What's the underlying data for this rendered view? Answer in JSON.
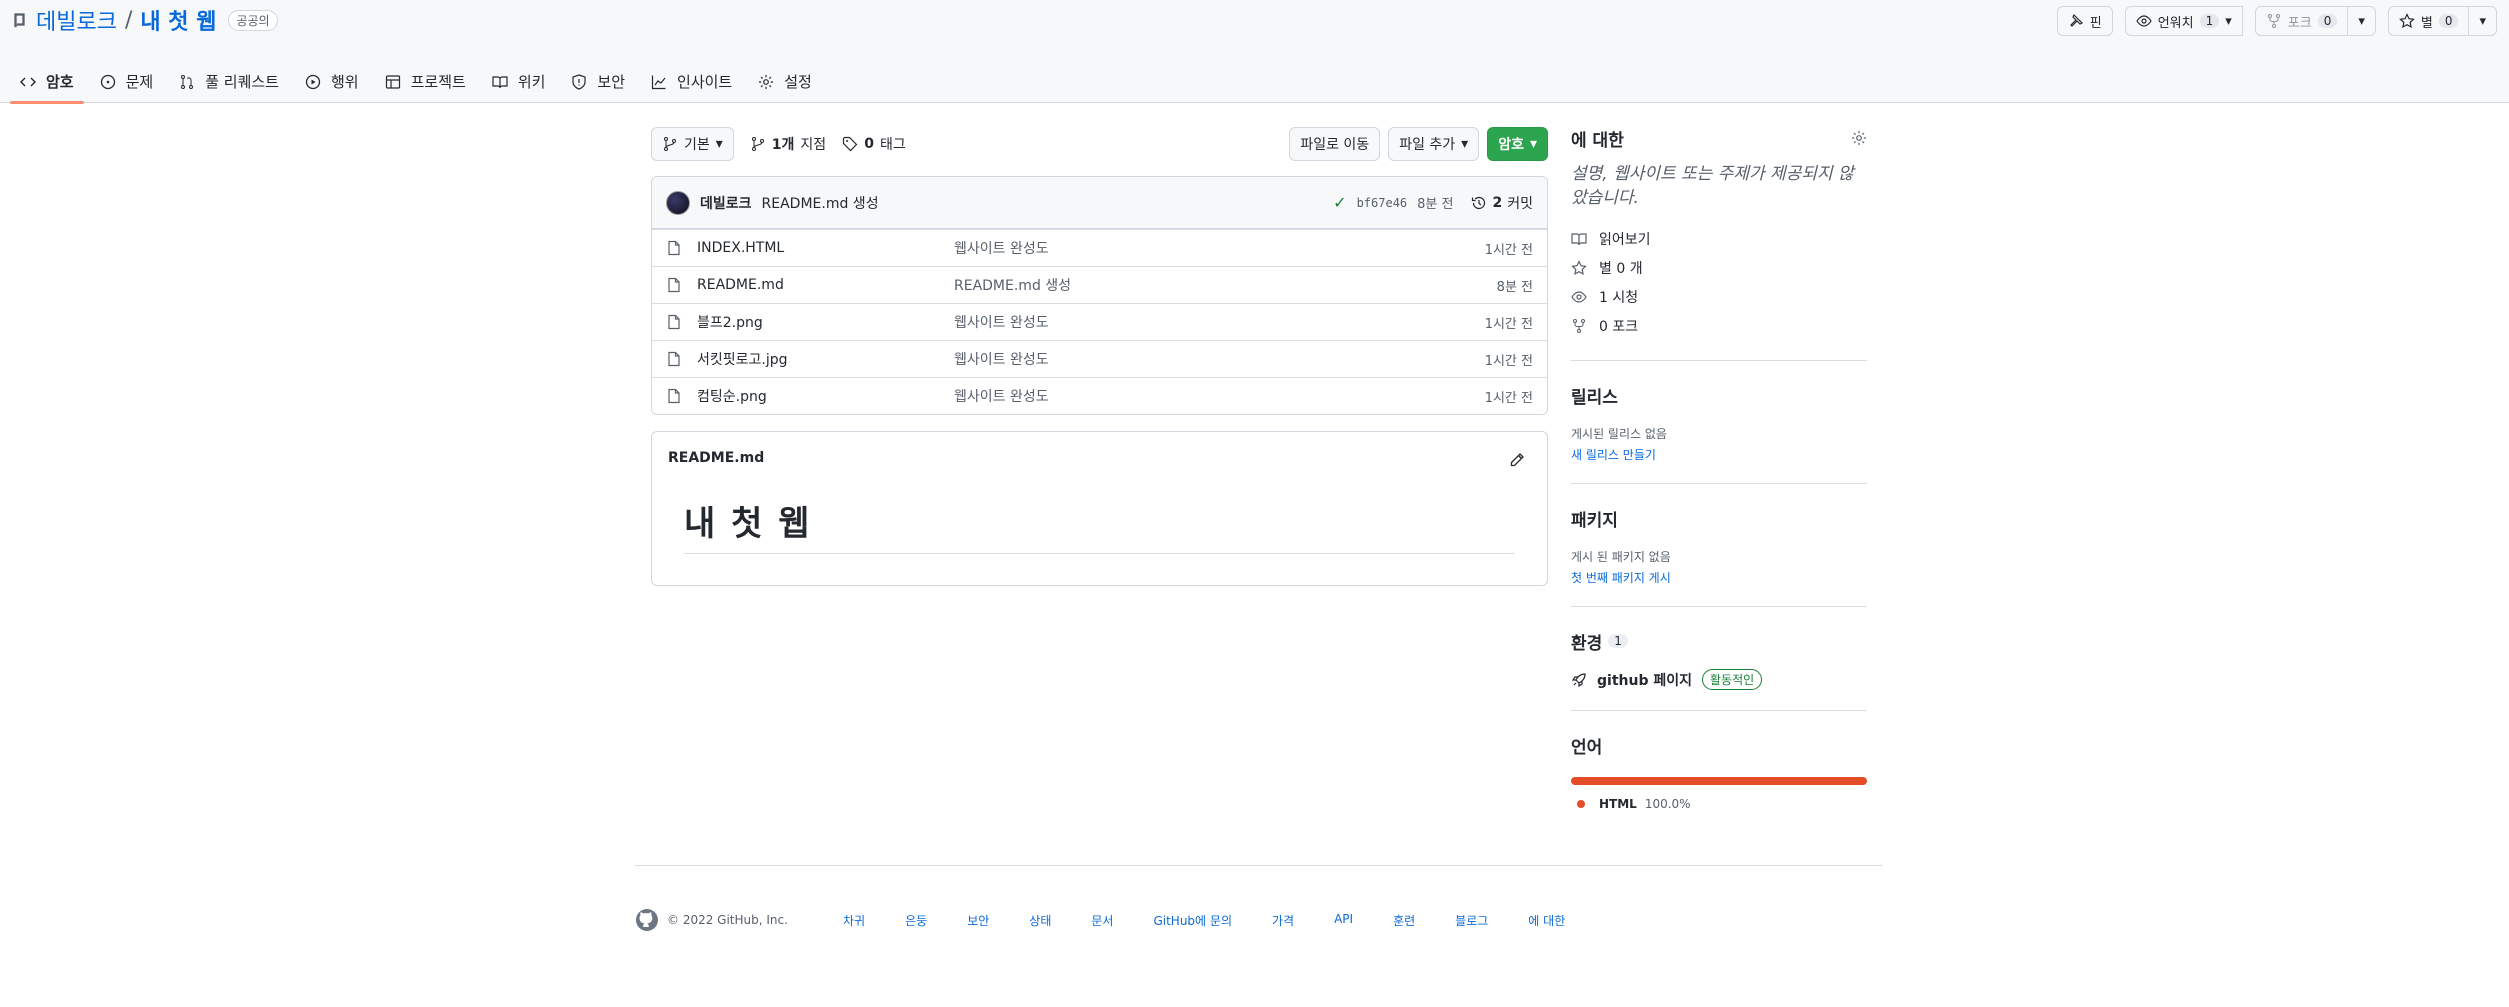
{
  "repo": {
    "owner": "데빌로크",
    "slash": "/",
    "name": "내 첫 웹",
    "visibility": "공공의"
  },
  "header_actions": {
    "pin_label": "핀",
    "watch_label": "언워치",
    "watch_count": "1",
    "fork_label": "포크",
    "fork_count": "0",
    "star_label": "별",
    "star_count": "0"
  },
  "tabs": [
    {
      "label": "암호",
      "icon": "code-icon"
    },
    {
      "label": "문제",
      "icon": "issue-icon"
    },
    {
      "label": "풀 리퀘스트",
      "icon": "pull-request-icon"
    },
    {
      "label": "행위",
      "icon": "play-icon"
    },
    {
      "label": "프로젝트",
      "icon": "table-icon"
    },
    {
      "label": "위키",
      "icon": "book-icon"
    },
    {
      "label": "보안",
      "icon": "shield-icon"
    },
    {
      "label": "인사이트",
      "icon": "graph-icon"
    },
    {
      "label": "설정",
      "icon": "gear-icon"
    }
  ],
  "toolbar": {
    "branch_label": "기본",
    "branches_count": "1개",
    "branches_label": "지점",
    "tags_count": "0",
    "tags_label": "태그",
    "goto_file": "파일로 이동",
    "add_file": "파일 추가",
    "code": "암호"
  },
  "commit": {
    "author": "데빌로크",
    "message": "README.md 생성",
    "sha": "bf67e46",
    "time": "8분 전",
    "commits_count": "2",
    "commits_label": "커밋"
  },
  "files": [
    {
      "name": "INDEX.HTML",
      "message": "웹사이트 완성도",
      "age": "1시간 전"
    },
    {
      "name": "README.md",
      "message": "README.md 생성",
      "age": "8분 전"
    },
    {
      "name": "블프2.png",
      "message": "웹사이트 완성도",
      "age": "1시간 전"
    },
    {
      "name": "서킷핏로고.jpg",
      "message": "웹사이트 완성도",
      "age": "1시간 전"
    },
    {
      "name": "컴팅순.png",
      "message": "웹사이트 완성도",
      "age": "1시간 전"
    }
  ],
  "readme": {
    "title": "README.md",
    "heading": "내 첫 웹"
  },
  "about": {
    "title": "에 대한",
    "description": "설명, 웹사이트 또는 주제가 제공되지 않았습니다.",
    "readme": "읽어보기",
    "stars": "별 0 개",
    "watching": "1 시청",
    "forks": "0 포크"
  },
  "releases": {
    "title": "릴리스",
    "none": "게시된 릴리스 없음",
    "create": "새 릴리스 만들기"
  },
  "packages": {
    "title": "패키지",
    "none": "게시 된 패키지 없음",
    "publish": "첫 번째 패키지 게시"
  },
  "environments": {
    "title": "환경",
    "count": "1",
    "name": "github 페이지",
    "status": "활동적인"
  },
  "languages": {
    "title": "언어",
    "items": [
      {
        "name": "HTML",
        "percent": "100.0%",
        "color": "#e34c26"
      }
    ]
  },
  "footer": {
    "copyright": "© 2022 GitHub, Inc.",
    "links": [
      "차귀",
      "은둥",
      "보안",
      "상태",
      "문서",
      "GitHub에 문의",
      "가격",
      "API",
      "훈련",
      "블로그",
      "에 대한"
    ]
  }
}
